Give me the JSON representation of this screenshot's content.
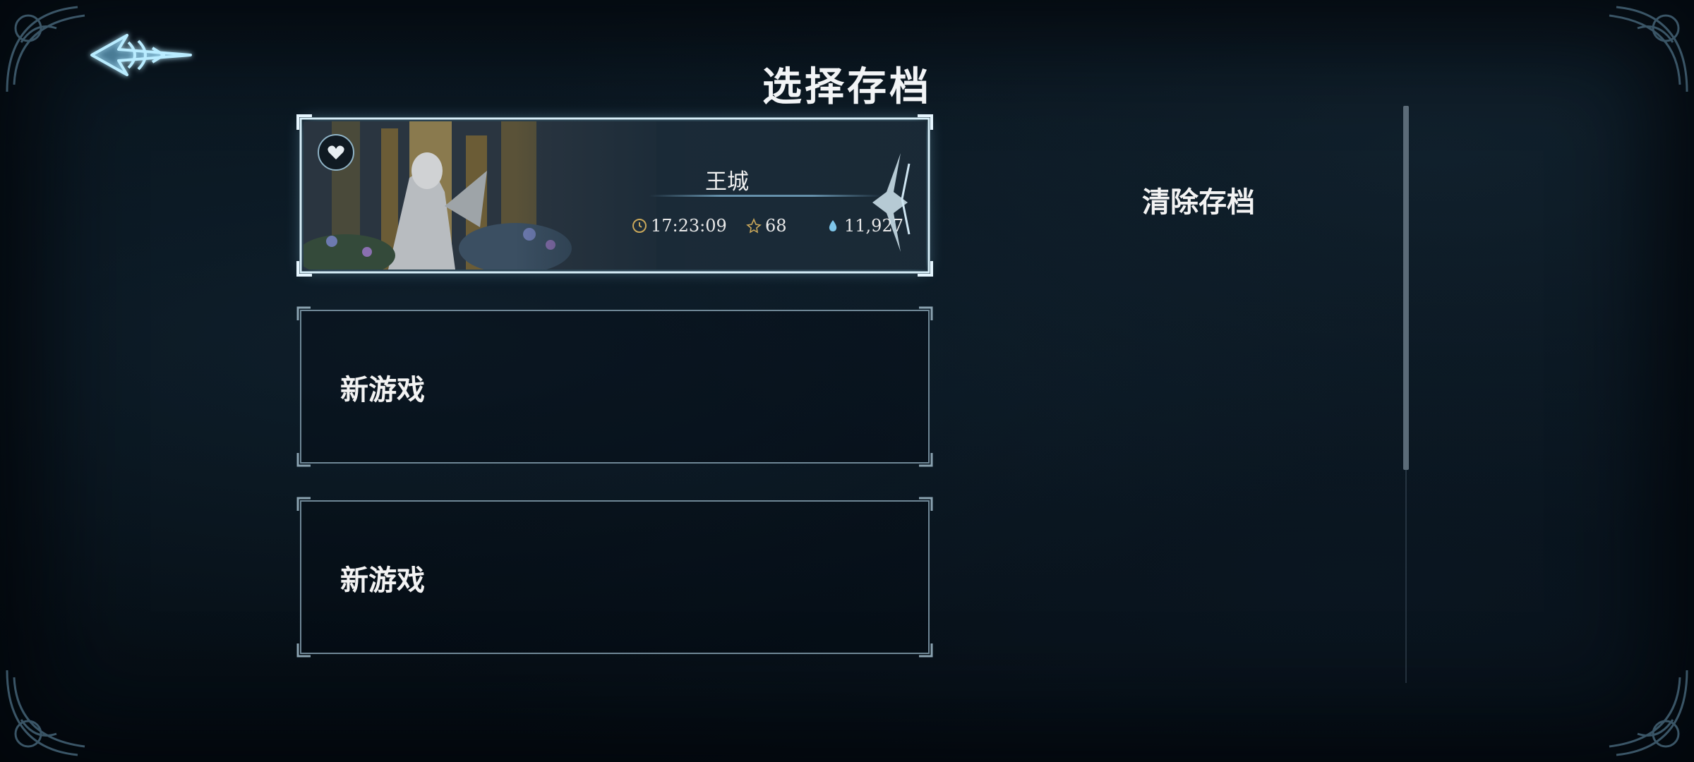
{
  "header": {
    "title": "选择存档",
    "back_icon": "back-arrow-icon"
  },
  "slots": [
    {
      "state": "saved",
      "location": "王城",
      "playtime": "17:23:09",
      "level": "68",
      "souls": "11,927",
      "badge_icon": "heart-badge-icon",
      "playtime_icon": "clock-icon",
      "level_icon": "level-icon",
      "souls_icon": "soul-drop-icon"
    },
    {
      "state": "empty",
      "label": "新游戏"
    },
    {
      "state": "empty",
      "label": "新游戏"
    }
  ],
  "actions": {
    "clear_label": "清除存档"
  },
  "colors": {
    "accent": "#8fd3f0",
    "frame": "#9fb2bf",
    "background": "#08131c",
    "stat_gold": "#c9a75a"
  }
}
